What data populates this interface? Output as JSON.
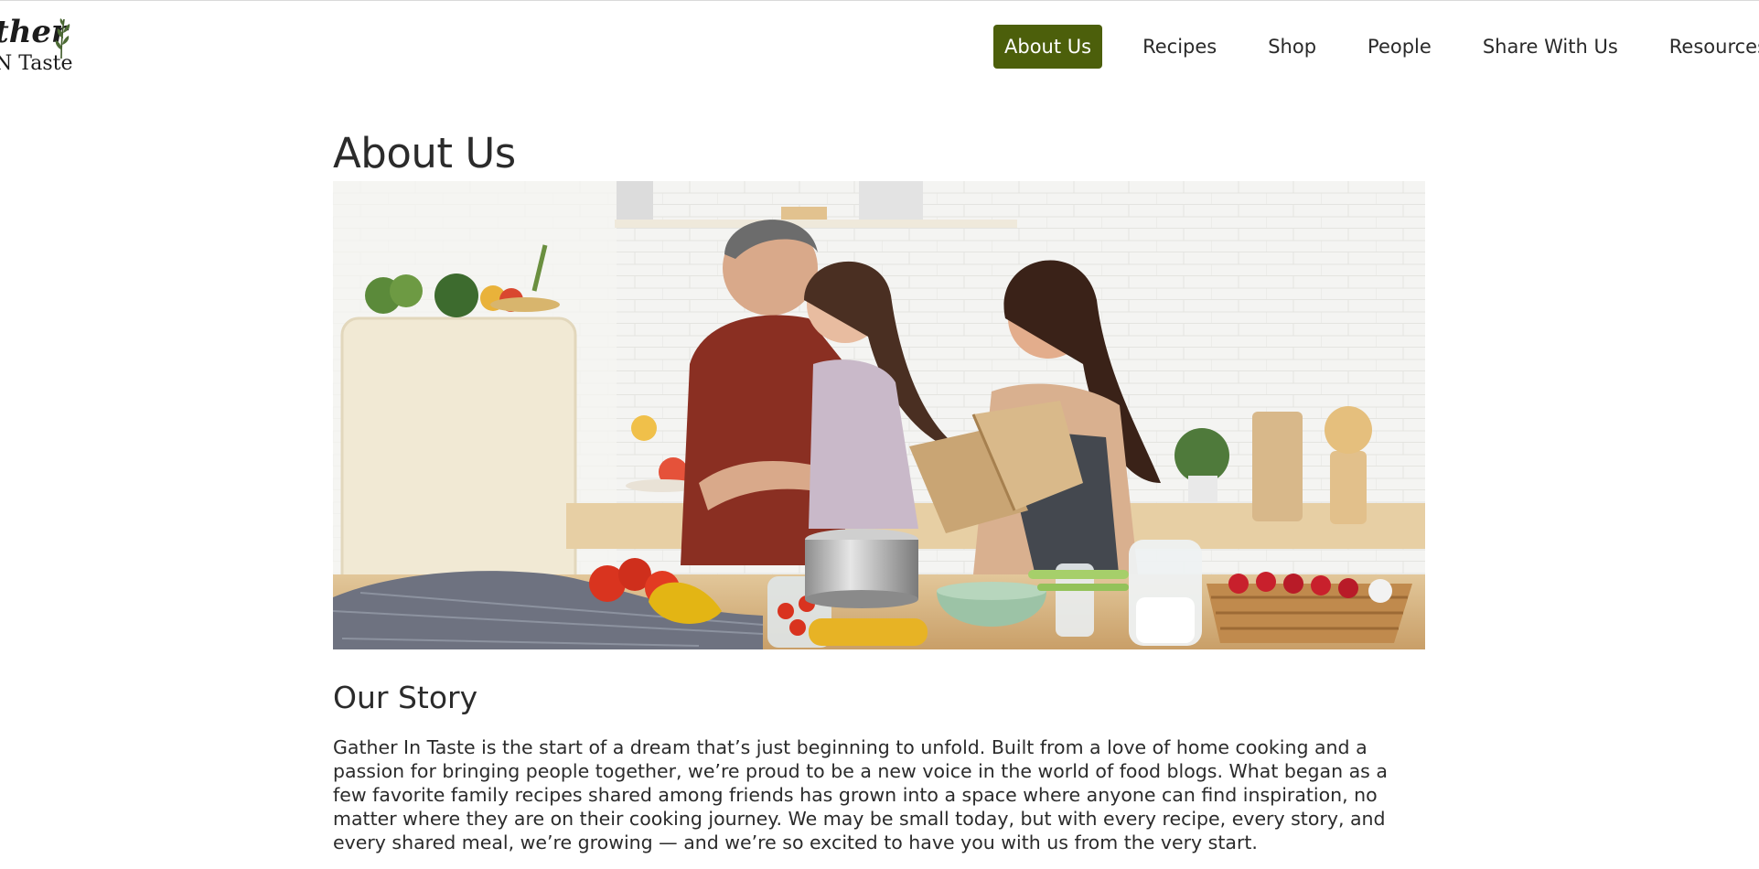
{
  "brand": {
    "logo_line1": "ther",
    "logo_line2": "N Taste",
    "accent_color": "#4c5f0b"
  },
  "nav": {
    "items": [
      {
        "label": "About Us",
        "active": true
      },
      {
        "label": "Recipes",
        "active": false
      },
      {
        "label": "Shop",
        "active": false
      },
      {
        "label": "People",
        "active": false
      },
      {
        "label": "Share With Us",
        "active": false
      },
      {
        "label": "Resources",
        "active": false
      }
    ]
  },
  "main": {
    "title": "About Us",
    "hero_image_icon": "family-cooking-photo",
    "section_heading": "Our Story",
    "story": "Gather In Taste is the start of a dream that’s just beginning to unfold. Built from a love of home cooking and a passion for bringing people together, we’re proud to be a new voice in the world of food blogs. What began as a few favorite family recipes shared among friends has grown into a space where anyone can find inspiration, no matter where they are on their cooking journey. We may be small today, but with every recipe, every story, and every shared meal, we’re growing — and we’re so excited to have you with us from the very start."
  }
}
